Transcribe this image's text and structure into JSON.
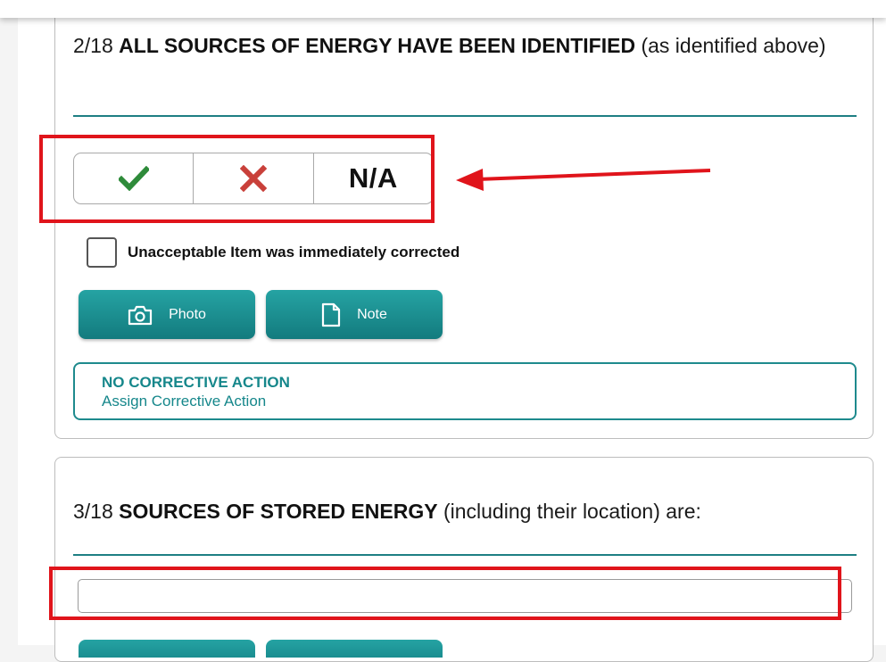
{
  "questions": [
    {
      "number": "2/18",
      "title_bold": "ALL SOURCES OF ENERGY HAVE BEEN IDENTIFIED",
      "title_rest": "(as identified above)",
      "options": [
        {
          "icon": "check-icon",
          "color": "#2e8b3a"
        },
        {
          "icon": "x-icon",
          "color": "#c0392b"
        },
        {
          "label": "N/A"
        }
      ],
      "corrected_checkbox_label": "Unacceptable Item was immediately corrected",
      "buttons": {
        "photo_label": "Photo",
        "note_label": "Note"
      },
      "corrective_action": {
        "title": "NO CORRECTIVE ACTION",
        "link": "Assign Corrective Action"
      }
    },
    {
      "number": "3/18",
      "title_bold": "SOURCES OF STORED ENERGY",
      "title_rest": "(including their location) are:",
      "input_value": ""
    }
  ],
  "colors": {
    "accent": "#1e7f83",
    "annotation": "#e0141b"
  }
}
